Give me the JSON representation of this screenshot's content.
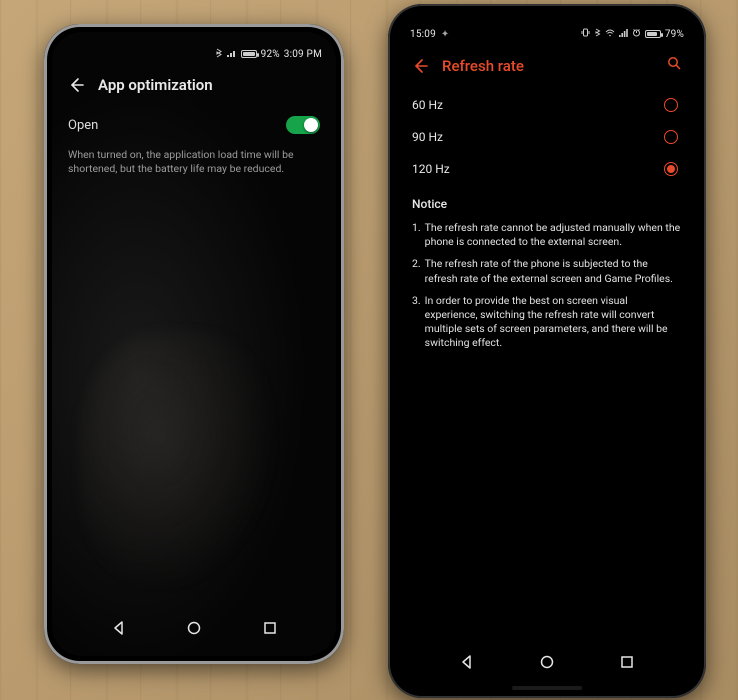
{
  "left_phone": {
    "status": {
      "battery_pct": "92%",
      "time": "3:09 PM"
    },
    "header": {
      "title": "App optimization"
    },
    "toggle": {
      "label": "Open",
      "on": true
    },
    "description": "When turned on, the application load time will be shortened, but the battery life may be reduced."
  },
  "right_phone": {
    "status": {
      "time": "15:09",
      "battery_pct": "79%"
    },
    "header": {
      "title": "Refresh rate"
    },
    "options": [
      {
        "label": "60 Hz",
        "selected": false
      },
      {
        "label": "90 Hz",
        "selected": false
      },
      {
        "label": "120 Hz",
        "selected": true
      }
    ],
    "notice_title": "Notice",
    "notices": [
      "The refresh rate cannot be adjusted manually when the phone is connected to the external screen.",
      "The refresh rate of the phone is subjected to the refresh rate of the external screen and Game Profiles.",
      "In order to provide the best on screen visual experience, switching the refresh rate will convert multiple sets of screen parameters, and there will be switching effect."
    ]
  }
}
